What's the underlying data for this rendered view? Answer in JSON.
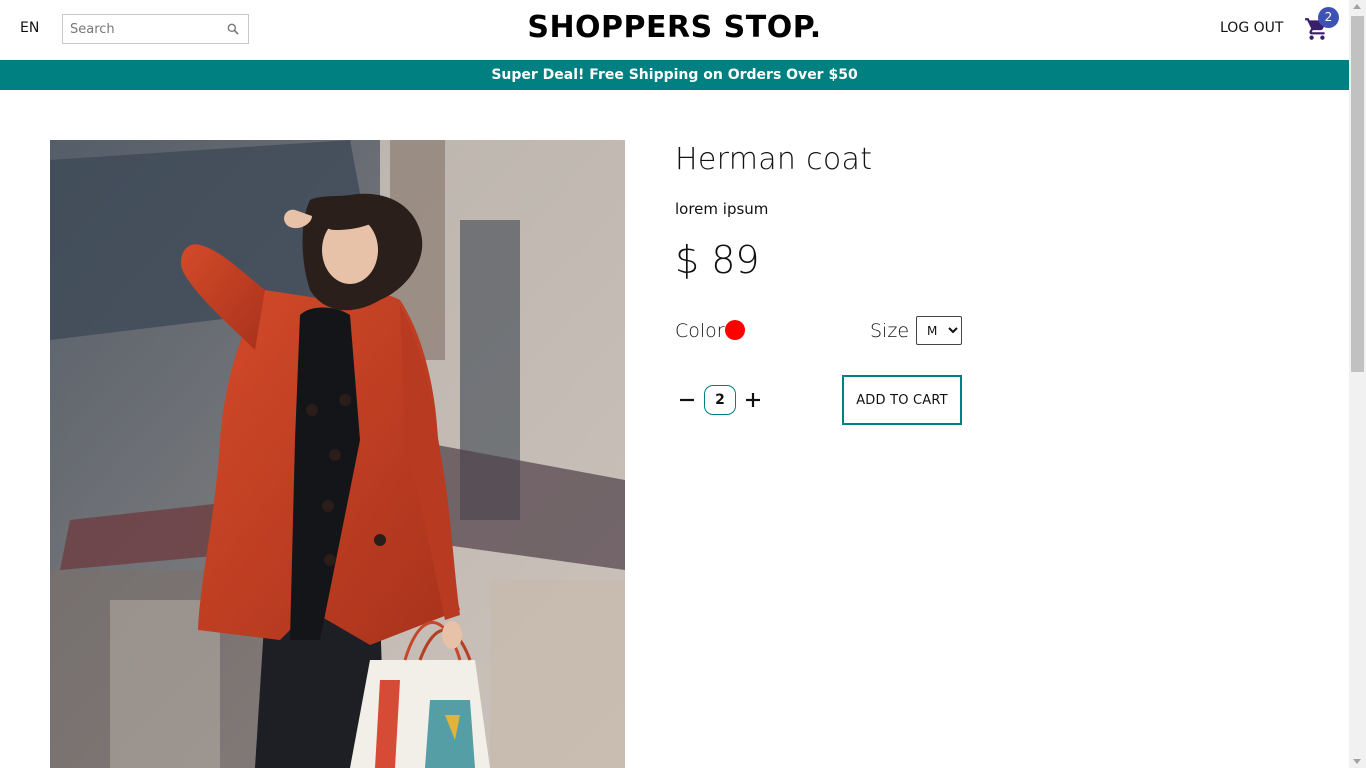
{
  "navbar": {
    "language": "EN",
    "search_placeholder": "Search",
    "logo": "SHOPPERS STOP.",
    "logout_label": "LOG OUT",
    "cart_count": "2"
  },
  "announcement": "Super Deal! Free Shipping on Orders Over $50",
  "product": {
    "title": "Herman coat",
    "description": "lorem ipsum",
    "price": "$ 89",
    "color_label": "Color",
    "color_value": "#ff0000",
    "size_label": "Size",
    "size_selected": "M",
    "quantity": "2",
    "add_to_cart_label": "ADD TO CART"
  },
  "colors": {
    "accent": "#008080",
    "badge": "#3f51b5"
  },
  "icons": [
    "search-icon",
    "cart-icon",
    "minus-icon",
    "plus-icon"
  ]
}
